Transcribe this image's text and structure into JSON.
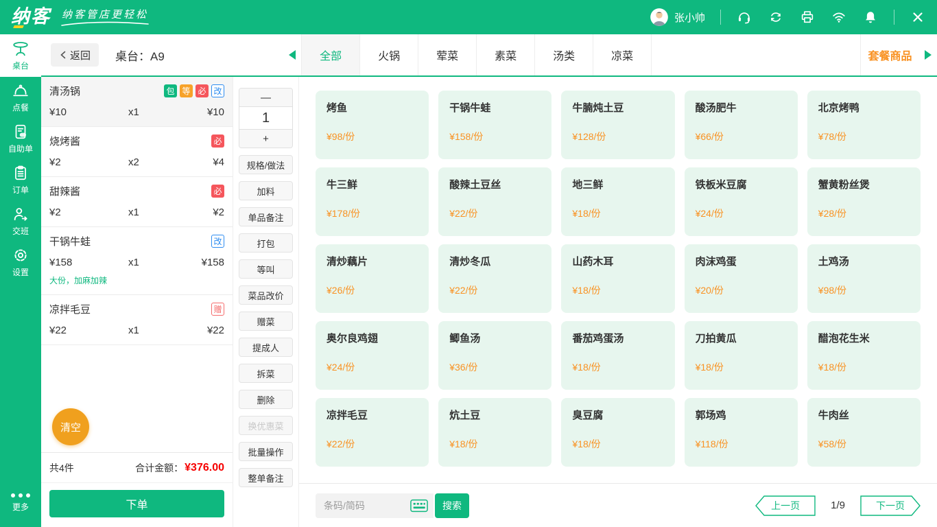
{
  "theme": {
    "green": "#0FB87F",
    "orange_accent": "#F99223",
    "badge_orange": "#F7A229",
    "badge_red": "#F5565C",
    "badge_blue": "#2D8CF0",
    "badge_gift_red": "#F56C6C",
    "clear_orange": "#F0A01E",
    "total_red": "#F60000",
    "card_mint": "#E7F6EE"
  },
  "header": {
    "logo_text": "纳客",
    "slogan": "纳客管店更轻松",
    "user_name": "张小帅",
    "icons": [
      "avatar",
      "headset",
      "sync",
      "printer",
      "wifi",
      "bell",
      "close"
    ]
  },
  "sidebar": {
    "items": [
      {
        "label": "桌台",
        "icon": "table-icon",
        "active": true
      },
      {
        "label": "点餐",
        "icon": "cloche-icon"
      },
      {
        "label": "自助单",
        "icon": "self-order-icon"
      },
      {
        "label": "订单",
        "icon": "order-list-icon"
      },
      {
        "label": "交班",
        "icon": "shift-icon"
      },
      {
        "label": "设置",
        "icon": "gear-icon"
      }
    ],
    "more_label": "更多"
  },
  "topbar": {
    "back_label": "返回",
    "table_label": "桌台：A9",
    "tabs": [
      {
        "label": "全部",
        "active": true
      },
      {
        "label": "火锅"
      },
      {
        "label": "荤菜"
      },
      {
        "label": "素菜"
      },
      {
        "label": "汤类"
      },
      {
        "label": "凉菜"
      }
    ],
    "combo_label": "套餐商品"
  },
  "cart": {
    "items": [
      {
        "name": "清汤锅",
        "price": "¥10",
        "qty": "x1",
        "total": "¥10",
        "selected": true,
        "badges": [
          {
            "text": "包",
            "style": "solid-green"
          },
          {
            "text": "等",
            "style": "solid-orange"
          },
          {
            "text": "必",
            "style": "solid-red"
          },
          {
            "text": "改",
            "style": "outline-blue"
          }
        ]
      },
      {
        "name": "烧烤酱",
        "price": "¥2",
        "qty": "x2",
        "total": "¥4",
        "badges": [
          {
            "text": "必",
            "style": "solid-red"
          }
        ]
      },
      {
        "name": "甜辣酱",
        "price": "¥2",
        "qty": "x1",
        "total": "¥2",
        "badges": [
          {
            "text": "必",
            "style": "solid-red"
          }
        ]
      },
      {
        "name": "干锅牛蛙",
        "price": "¥158",
        "qty": "x1",
        "total": "¥158",
        "note": "大份，加麻加辣",
        "badges": [
          {
            "text": "改",
            "style": "outline-blue"
          }
        ]
      },
      {
        "name": "凉拌毛豆",
        "price": "¥22",
        "qty": "x1",
        "total": "¥22",
        "badges": [
          {
            "text": "赠",
            "style": "outline-red"
          }
        ]
      }
    ],
    "clear_label": "清空",
    "count_label": "共4件",
    "total_label": "合计金额：",
    "total_value": "¥376.00",
    "submit_label": "下单"
  },
  "actions": {
    "minus_label": "—",
    "qty_value": "1",
    "plus_label": "+",
    "buttons": [
      {
        "label": "规格/做法"
      },
      {
        "label": "加料"
      },
      {
        "label": "单品备注"
      },
      {
        "label": "打包"
      },
      {
        "label": "等叫"
      },
      {
        "label": "菜品改价"
      },
      {
        "label": "赠菜"
      },
      {
        "label": "提成人"
      },
      {
        "label": "拆菜"
      },
      {
        "label": "删除"
      },
      {
        "label": "换优惠菜",
        "disabled": true
      },
      {
        "label": "批量操作"
      },
      {
        "label": "整单备注"
      }
    ]
  },
  "products": [
    {
      "name": "烤鱼",
      "price": "¥98/份"
    },
    {
      "name": "干锅牛蛙",
      "price": "¥158/份"
    },
    {
      "name": "牛腩炖土豆",
      "price": "¥128/份"
    },
    {
      "name": "酸汤肥牛",
      "price": "¥66/份"
    },
    {
      "name": "北京烤鸭",
      "price": "¥78/份"
    },
    {
      "name": "牛三鲜",
      "price": "¥178/份"
    },
    {
      "name": "酸辣土豆丝",
      "price": "¥22/份"
    },
    {
      "name": "地三鲜",
      "price": "¥18/份"
    },
    {
      "name": "铁板米豆腐",
      "price": "¥24/份"
    },
    {
      "name": "蟹黄粉丝煲",
      "price": "¥28/份"
    },
    {
      "name": "清炒藕片",
      "price": "¥26/份"
    },
    {
      "name": "清炒冬瓜",
      "price": "¥22/份"
    },
    {
      "name": "山药木耳",
      "price": "¥18/份"
    },
    {
      "name": "肉沫鸡蛋",
      "price": "¥20/份"
    },
    {
      "name": "土鸡汤",
      "price": "¥98/份"
    },
    {
      "name": "奥尔良鸡翅",
      "price": "¥24/份"
    },
    {
      "name": "鲫鱼汤",
      "price": "¥36/份"
    },
    {
      "name": "番茄鸡蛋汤",
      "price": "¥18/份"
    },
    {
      "name": "刀拍黄瓜",
      "price": "¥18/份"
    },
    {
      "name": "醋泡花生米",
      "price": "¥18/份"
    },
    {
      "name": "凉拌毛豆",
      "price": "¥22/份"
    },
    {
      "name": "炕土豆",
      "price": "¥18/份"
    },
    {
      "name": "臭豆腐",
      "price": "¥18/份"
    },
    {
      "name": "郭场鸡",
      "price": "¥118/份"
    },
    {
      "name": "牛肉丝",
      "price": "¥58/份"
    }
  ],
  "footer": {
    "search_placeholder": "条码/简码",
    "search_label": "搜索",
    "prev_label": "上一页",
    "page_indicator": "1/9",
    "next_label": "下一页"
  }
}
